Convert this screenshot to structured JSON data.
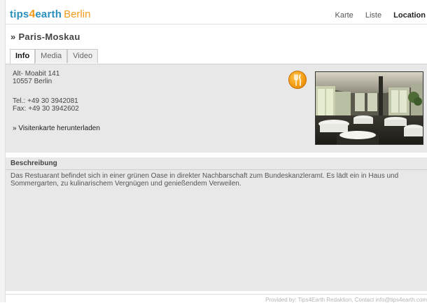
{
  "header": {
    "logo": {
      "brand_prefix": "tips",
      "brand_digit": "4",
      "brand_suffix": "earth",
      "city": "Berlin"
    },
    "nav": [
      {
        "label": "Karte",
        "active": false
      },
      {
        "label": "Liste",
        "active": false
      },
      {
        "label": "Location",
        "active": true
      }
    ]
  },
  "place": {
    "title": "» Paris-Moskau",
    "tabs": [
      {
        "label": "Info",
        "active": true
      },
      {
        "label": "Media",
        "active": false
      },
      {
        "label": "Video",
        "active": false
      }
    ],
    "address": {
      "street": "Alt- Moabit 141",
      "city": "10557 Berlin"
    },
    "contact": {
      "phone": "Tel.: +49 30 3942081",
      "fax": "Fax: +49 30 3942602"
    },
    "vcard_link": "» Visitenkarte herunterladen",
    "category_icon": "fork-knife-icon",
    "photo": "restaurant-interior-photo"
  },
  "description": {
    "heading": "Beschreibung",
    "text": "Das Restuarant befindet sich in einer grünen Oase in direkter Nachbarschaft zum Bundeskanzleramt. Es lädt ein in Haus und Sommergarten, zu kulinarischem Vergnügen und genießendem Verweilen."
  },
  "footer": {
    "credit": "Provided by: Tips4Earth Redaktion, Contact info@tips4earth.com"
  },
  "colors": {
    "brand_blue": "#2a8fbd",
    "brand_orange": "#f39a1a",
    "panel_gray": "#e8e8e8"
  }
}
